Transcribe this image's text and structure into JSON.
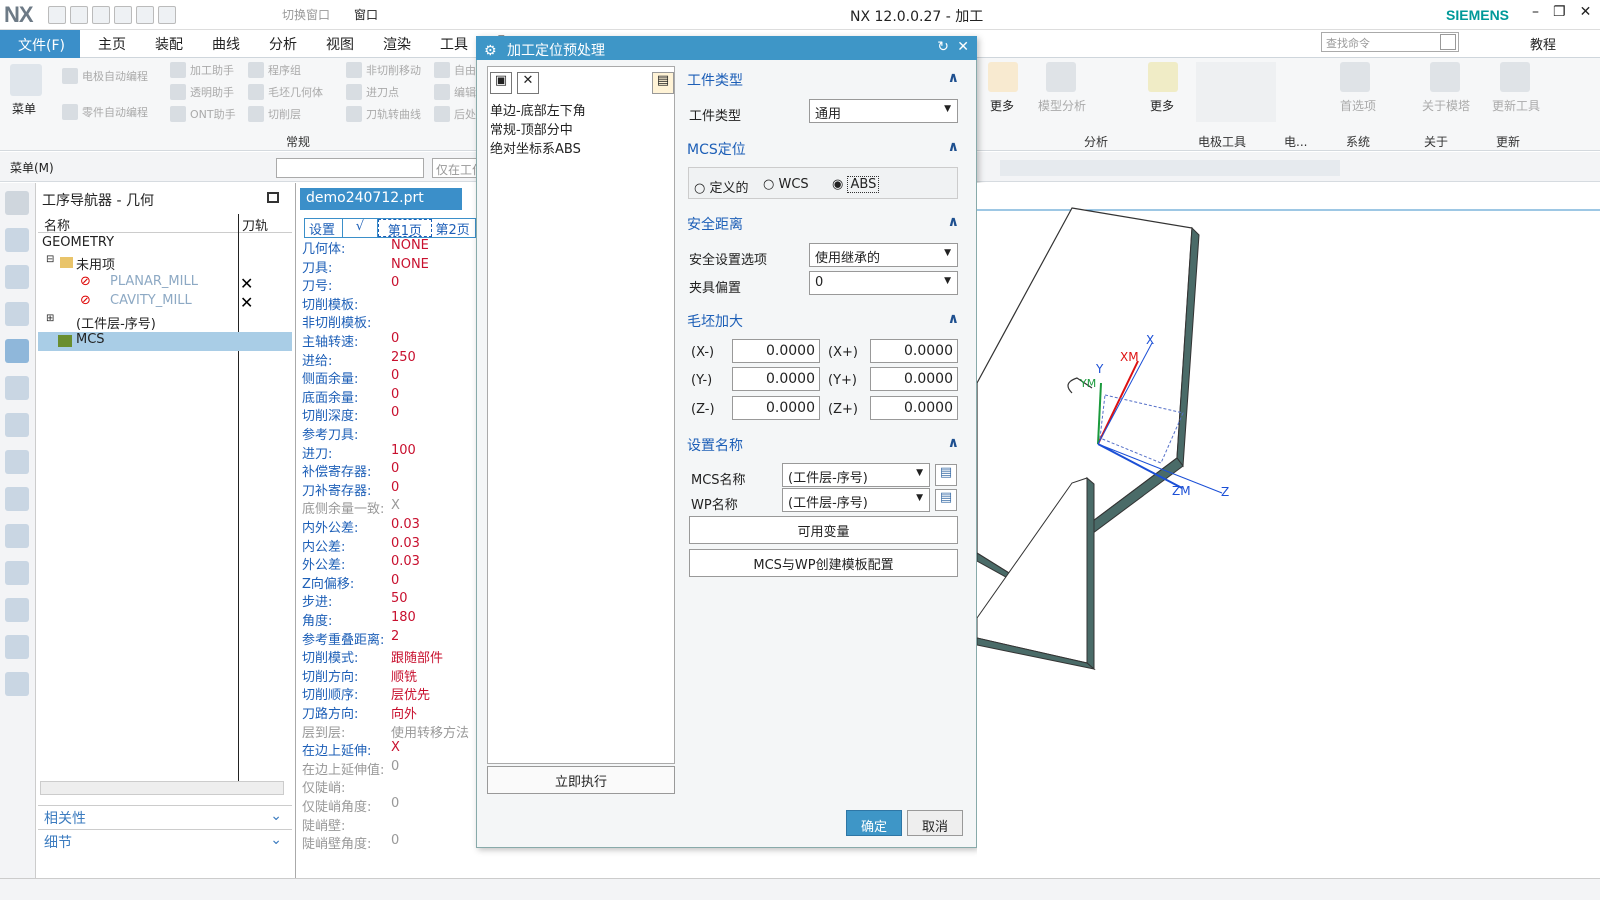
{
  "app": {
    "logo": "NX",
    "title": "NX 12.0.0.27 - 加工",
    "brand": "SIEMENS",
    "switch_window": "切换窗口",
    "window": "窗口"
  },
  "menu": {
    "file": "文件(F)",
    "tabs": [
      "主页",
      "装配",
      "曲线",
      "分析",
      "视图",
      "渲染",
      "工具",
      "F"
    ],
    "search_placeholder": "查找命令",
    "tutorial": "教程"
  },
  "ribbon": {
    "menu_label": "菜单",
    "left_items": [
      "电极自动编程",
      "零件自动编程",
      "加工助手",
      "透明助手",
      "ONT助手",
      "程序组",
      "毛坯几何体",
      "切削层",
      "非切削移动",
      "进刀点",
      "刀轨转曲线",
      "自由",
      "编辑",
      "后处"
    ],
    "group_common": "常规",
    "more": "更多",
    "model_analysis": "模型分析",
    "first_item": "首选项",
    "about_mold": "关于模塔",
    "update_tool": "更新工具",
    "groups_right": [
      "分析",
      "电极工具",
      "电...",
      "系统",
      "关于",
      "更新"
    ]
  },
  "toolbar2": {
    "menu_btn": "菜单(M)",
    "only_in": "仅在工作"
  },
  "nav": {
    "title": "工序导航器 - 几何",
    "col_name": "名称",
    "col_path": "刀轨",
    "rows": [
      "GEOMETRY",
      "未用项",
      "PLANAR_MILL",
      "CAVITY_MILL",
      "(工件层-序号)",
      "MCS"
    ],
    "relevance": "相关性",
    "detail": "细节"
  },
  "doc": {
    "tab": "demo240712.prt",
    "subtabs": [
      "设置",
      "√",
      "第1页",
      "第2页"
    ]
  },
  "props": [
    {
      "k": "几何体:",
      "v": "NONE"
    },
    {
      "k": "刀具:",
      "v": "NONE"
    },
    {
      "k": "刀号:",
      "v": "0"
    },
    {
      "k": "切削模板:",
      "v": ""
    },
    {
      "k": "非切削模板:",
      "v": ""
    },
    {
      "k": "主轴转速:",
      "v": "0"
    },
    {
      "k": "进给:",
      "v": "250"
    },
    {
      "k": "侧面余量:",
      "v": "0"
    },
    {
      "k": "底面余量:",
      "v": "0"
    },
    {
      "k": "切削深度:",
      "v": "0"
    },
    {
      "k": "参考刀具:",
      "v": ""
    },
    {
      "k": "进刀:",
      "v": "100"
    },
    {
      "k": "补偿寄存器:",
      "v": "0"
    },
    {
      "k": "刀补寄存器:",
      "v": "0"
    },
    {
      "k": "底侧余量一致:",
      "v": "X"
    },
    {
      "k": "内外公差:",
      "v": "0.03"
    },
    {
      "k": "内公差:",
      "v": "0.03"
    },
    {
      "k": "外公差:",
      "v": "0.03"
    },
    {
      "k": "Z向偏移:",
      "v": "0"
    },
    {
      "k": "步进:",
      "v": "50"
    },
    {
      "k": "角度:",
      "v": "180"
    },
    {
      "k": "参考重叠距离:",
      "v": "2"
    },
    {
      "k": "切削模式:",
      "v": "跟随部件"
    },
    {
      "k": "切削方向:",
      "v": "顺铣"
    },
    {
      "k": "切削顺序:",
      "v": "层优先"
    },
    {
      "k": "刀路方向:",
      "v": "向外"
    },
    {
      "k": "层到层:",
      "v": "使用转移方法"
    },
    {
      "k": "在边上延伸:",
      "v": "X"
    },
    {
      "k": "在边上延伸值:",
      "v": "0"
    },
    {
      "k": "仅陡峭:",
      "v": ""
    },
    {
      "k": "仅陡峭角度:",
      "v": "0"
    },
    {
      "k": "陡峭壁:",
      "v": ""
    },
    {
      "k": "陡峭壁角度:",
      "v": "0"
    }
  ],
  "dialog": {
    "title": "加工定位预处理",
    "list": [
      "单边-底部左下角",
      "常规-顶部分中",
      "绝对坐标系ABS"
    ],
    "run_now": "立即执行",
    "sec_type": "工件类型",
    "type_label": "工件类型",
    "type_value": "通用",
    "sec_mcs": "MCS定位",
    "radios": [
      "定义的",
      "WCS",
      "ABS"
    ],
    "sec_safe": "安全距离",
    "safe_label": "安全设置选项",
    "safe_value": "使用继承的",
    "clamp_label": "夹具偏置",
    "clamp_value": "0",
    "sec_blank": "毛坯加大",
    "blank": [
      {
        "a": "(X-)",
        "av": "0.0000",
        "b": "(X+)",
        "bv": "0.0000"
      },
      {
        "a": "(Y-)",
        "av": "0.0000",
        "b": "(Y+)",
        "bv": "0.0000"
      },
      {
        "a": "(Z-)",
        "av": "0.0000",
        "b": "(Z+)",
        "bv": "0.0000"
      }
    ],
    "sec_name": "设置名称",
    "mcs_name_label": "MCS名称",
    "mcs_name_value": "(工件层-序号)",
    "wp_name_label": "WP名称",
    "wp_name_value": "(工件层-序号)",
    "vars_btn": "可用变量",
    "template_btn": "MCS与WP创建模板配置",
    "ok": "确定",
    "cancel": "取消"
  },
  "viewport": {
    "axes": [
      "X",
      "Y",
      "XM",
      "YM",
      "ZM",
      "Z"
    ]
  }
}
